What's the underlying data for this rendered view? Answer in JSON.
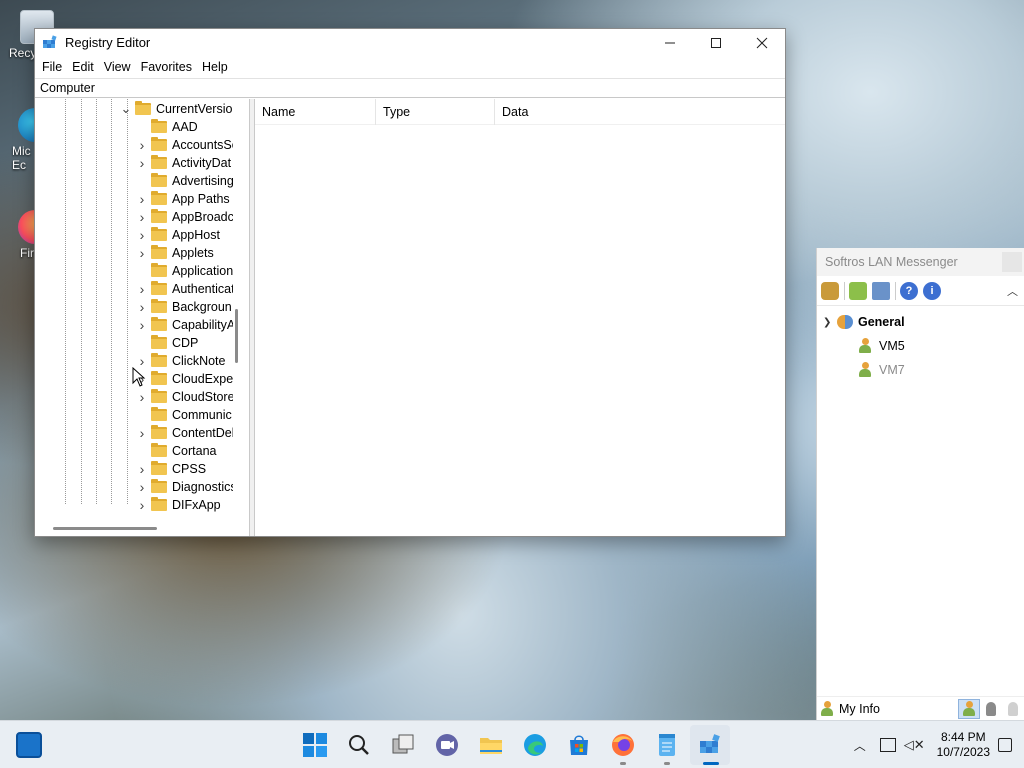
{
  "desktop": {
    "icons": [
      {
        "label": "Recy",
        "icon": "recycle-bin-icon"
      },
      {
        "label": "Mic\nEc",
        "icon": "edge-icon"
      },
      {
        "label": "Fir",
        "icon": "firefox-icon"
      }
    ]
  },
  "regedit": {
    "title": "Registry Editor",
    "menu": [
      "File",
      "Edit",
      "View",
      "Favorites",
      "Help"
    ],
    "address": "Computer",
    "tree": [
      {
        "label": "CurrentVersion",
        "expander": "expanded",
        "level": 0
      },
      {
        "label": "AAD",
        "expander": "none",
        "level": 1
      },
      {
        "label": "AccountsSe",
        "expander": "collapsed",
        "level": 1
      },
      {
        "label": "ActivityDat",
        "expander": "collapsed",
        "level": 1
      },
      {
        "label": "Advertising",
        "expander": "none",
        "level": 1
      },
      {
        "label": "App Paths",
        "expander": "collapsed",
        "level": 1
      },
      {
        "label": "AppBroadc",
        "expander": "collapsed",
        "level": 1
      },
      {
        "label": "AppHost",
        "expander": "collapsed",
        "level": 1
      },
      {
        "label": "Applets",
        "expander": "collapsed",
        "level": 1
      },
      {
        "label": "Application",
        "expander": "none",
        "level": 1
      },
      {
        "label": "Authenticat",
        "expander": "collapsed",
        "level": 1
      },
      {
        "label": "Backgroun",
        "expander": "collapsed",
        "level": 1
      },
      {
        "label": "CapabilityA",
        "expander": "collapsed",
        "level": 1
      },
      {
        "label": "CDP",
        "expander": "none",
        "level": 1
      },
      {
        "label": "ClickNote",
        "expander": "collapsed",
        "level": 1
      },
      {
        "label": "CloudExper",
        "expander": "collapsed",
        "level": 1
      },
      {
        "label": "CloudStore",
        "expander": "collapsed",
        "level": 1
      },
      {
        "label": "Communic",
        "expander": "none",
        "level": 1
      },
      {
        "label": "ContentDel",
        "expander": "collapsed",
        "level": 1
      },
      {
        "label": "Cortana",
        "expander": "none",
        "level": 1
      },
      {
        "label": "CPSS",
        "expander": "collapsed",
        "level": 1
      },
      {
        "label": "Diagnostics",
        "expander": "collapsed",
        "level": 1
      },
      {
        "label": "DIFxApp",
        "expander": "collapsed",
        "level": 1
      }
    ],
    "columns": [
      "Name",
      "Type",
      "Data"
    ]
  },
  "softros": {
    "title": "Softros LAN Messenger",
    "group": "General",
    "users": [
      {
        "name": "VM5",
        "online": true
      },
      {
        "name": "VM7",
        "online": false
      }
    ],
    "my_info": "My Info"
  },
  "taskbar": {
    "time": "8:44 PM",
    "date": "10/7/2023",
    "apps": [
      "start",
      "search",
      "task-view",
      "teams",
      "file-explorer",
      "edge",
      "store",
      "firefox",
      "notepad",
      "regedit"
    ]
  },
  "colors": {
    "accent": "#0067c0",
    "folder": "#f1c550"
  }
}
